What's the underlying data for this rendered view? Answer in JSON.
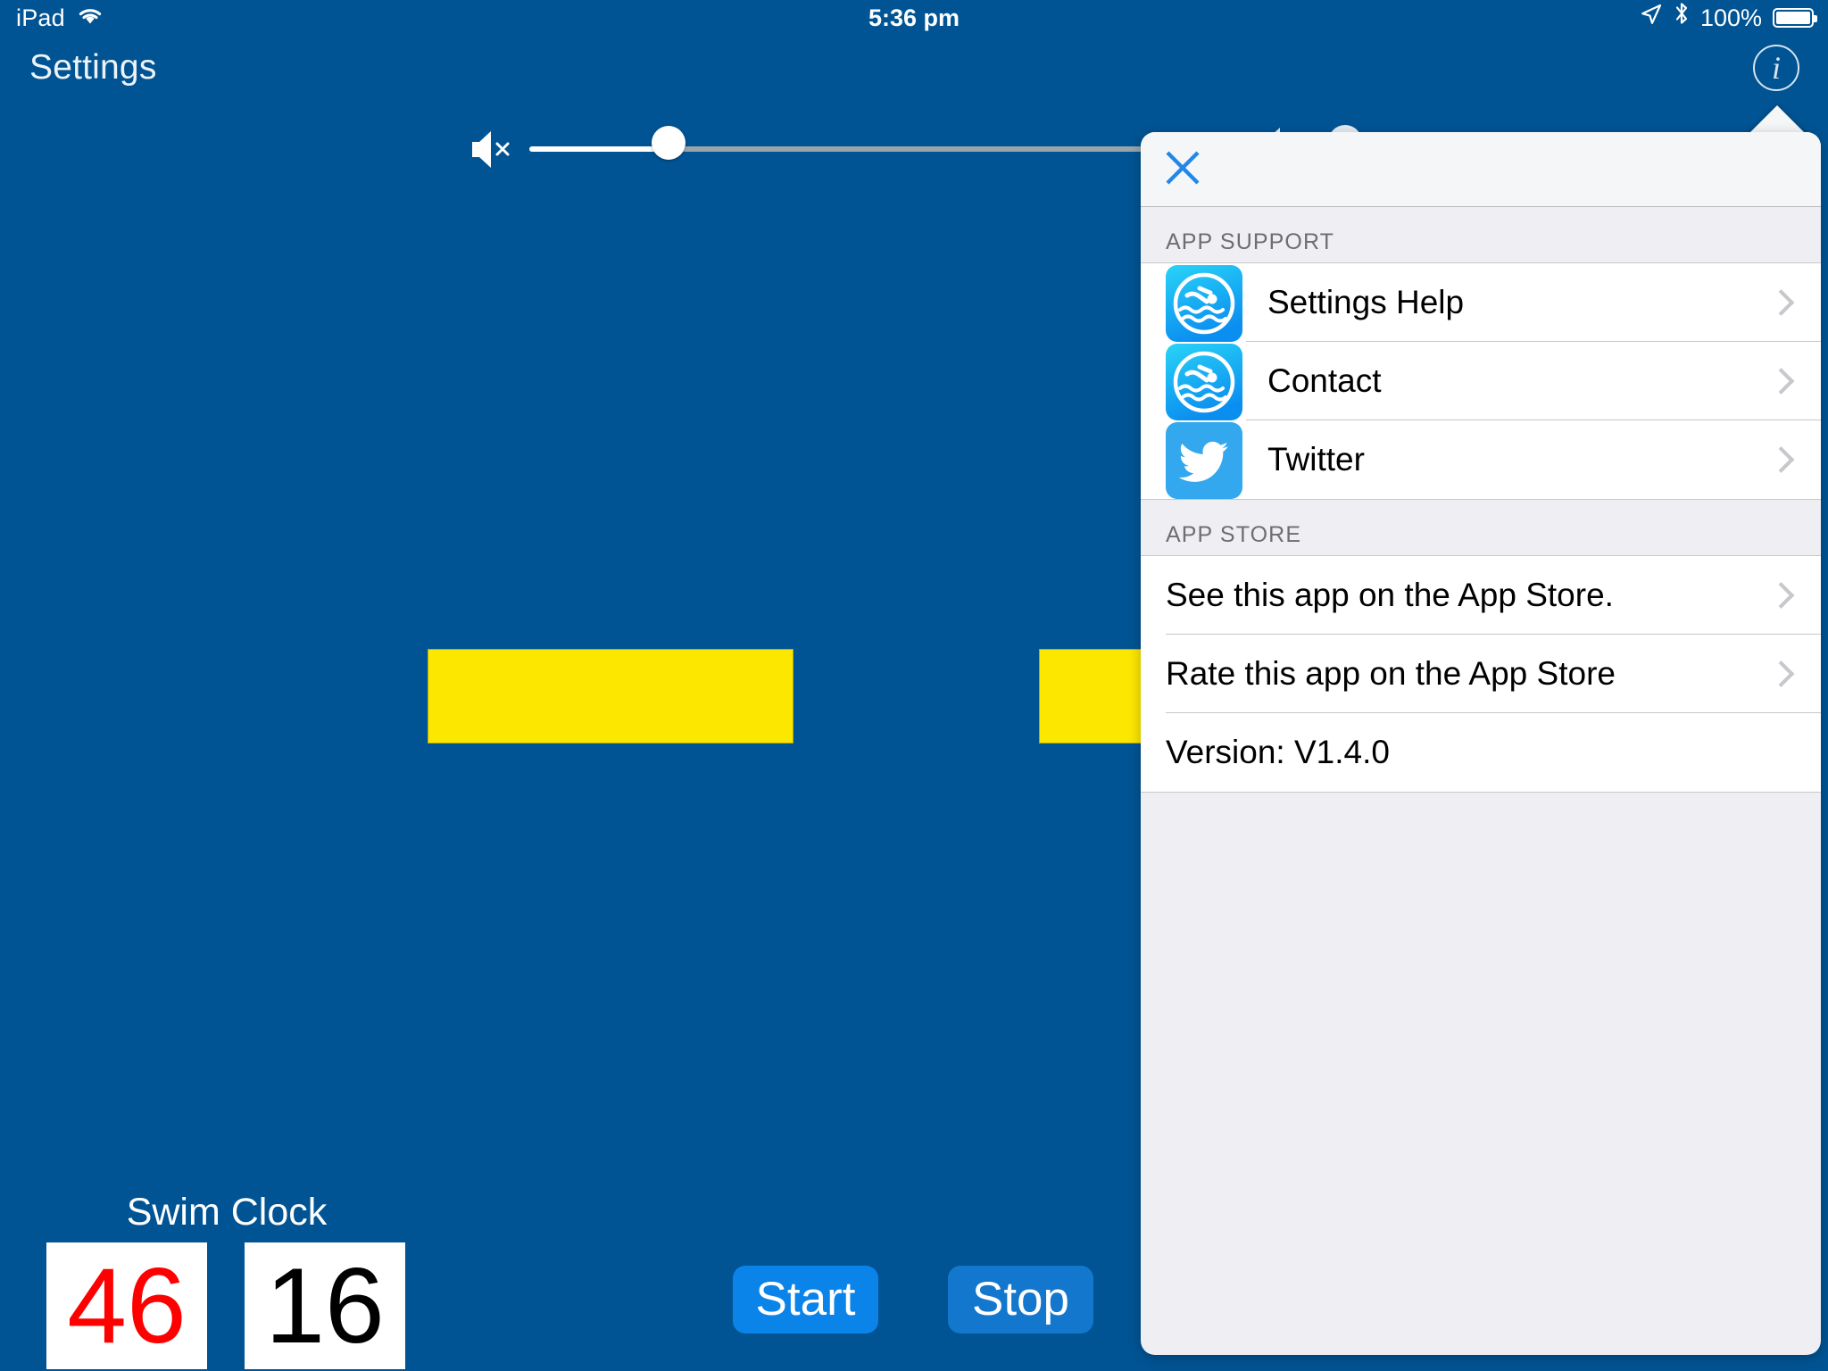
{
  "status_bar": {
    "device_label": "iPad",
    "wifi_icon": "wifi-icon",
    "time": "5:36 pm",
    "location_icon": "location-arrow-icon",
    "bluetooth_icon": "bluetooth-icon",
    "battery_percent": "100%",
    "battery_icon": "battery-full-icon"
  },
  "nav_bar": {
    "title": "Settings",
    "info_button_glyph": "i",
    "info_icon_name": "info-circle-icon"
  },
  "volume": {
    "mute_icon_name": "speaker-mute-icon",
    "slider_name": "volume-slider",
    "value_fraction": 0.124
  },
  "stage": {
    "bar_color": "#fbe700",
    "bars": [
      {
        "name": "yellow-bar-1"
      },
      {
        "name": "yellow-bar-2"
      }
    ]
  },
  "swim_clock": {
    "title": "Swim Clock",
    "left_value": "46",
    "left_color": "#ff0000",
    "right_value": "16",
    "right_color": "#000000"
  },
  "controls": {
    "start_label": "Start",
    "stop_label": "Stop",
    "start_color": "#0a84e8",
    "stop_color": "#1277cd"
  },
  "popover": {
    "close_label": "×",
    "close_icon_name": "close-x-icon",
    "close_color": "#2387e8",
    "sections": [
      {
        "header": "APP SUPPORT",
        "rows": [
          {
            "label": "Settings Help",
            "icon": "swim-app-icon",
            "chevron": true
          },
          {
            "label": "Contact",
            "icon": "swim-app-icon",
            "chevron": true
          },
          {
            "label": "Twitter",
            "icon": "twitter-icon",
            "chevron": true
          }
        ]
      },
      {
        "header": "APP STORE",
        "rows": [
          {
            "label": "See this app on the App Store.",
            "icon": null,
            "chevron": true
          },
          {
            "label": "Rate this app on the App Store",
            "icon": null,
            "chevron": true
          },
          {
            "label": "Version:  V1.4.0",
            "icon": null,
            "chevron": false
          }
        ]
      }
    ]
  }
}
